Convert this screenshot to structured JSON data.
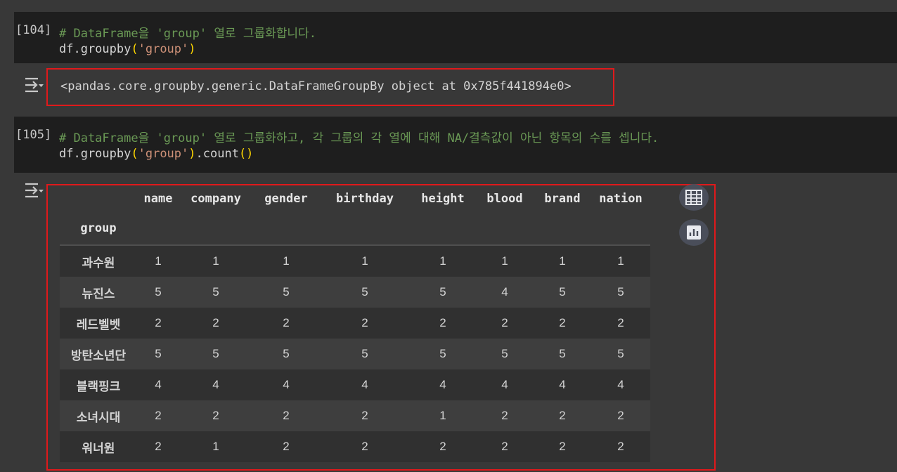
{
  "cell104": {
    "prompt": "[104]",
    "comment": "# DataFrame을 'group' 열로 그룹화합니다.",
    "code_obj": "df.groupby",
    "code_open": "(",
    "code_arg": "'group'",
    "code_close": ")",
    "output": "<pandas.core.groupby.generic.DataFrameGroupBy object at 0x785f441894e0>"
  },
  "cell105": {
    "prompt": "[105]",
    "comment": "# DataFrame을 'group' 열로 그룹화하고, 각 그룹의 각 열에 대해 NA/결측값이 아닌 항목의 수를 셉니다.",
    "code_obj": "df.groupby",
    "code_open": "(",
    "code_arg": "'group'",
    "code_close": ")",
    "code_tail": ".count",
    "code_tail_parens": "()"
  },
  "dataframe": {
    "index_name": "group",
    "columns": [
      "name",
      "company",
      "gender",
      "birthday",
      "height",
      "blood",
      "brand",
      "nation"
    ],
    "rows": [
      {
        "index": "과수원",
        "values": [
          "1",
          "1",
          "1",
          "1",
          "1",
          "1",
          "1",
          "1"
        ]
      },
      {
        "index": "뉴진스",
        "values": [
          "5",
          "5",
          "5",
          "5",
          "5",
          "4",
          "5",
          "5"
        ]
      },
      {
        "index": "레드벨벳",
        "values": [
          "2",
          "2",
          "2",
          "2",
          "2",
          "2",
          "2",
          "2"
        ]
      },
      {
        "index": "방탄소년단",
        "values": [
          "5",
          "5",
          "5",
          "5",
          "5",
          "5",
          "5",
          "5"
        ]
      },
      {
        "index": "블랙핑크",
        "values": [
          "4",
          "4",
          "4",
          "4",
          "4",
          "4",
          "4",
          "4"
        ]
      },
      {
        "index": "소녀시대",
        "values": [
          "2",
          "2",
          "2",
          "2",
          "1",
          "2",
          "2",
          "2"
        ]
      },
      {
        "index": "워너원",
        "values": [
          "2",
          "1",
          "2",
          "2",
          "2",
          "2",
          "2",
          "2"
        ]
      }
    ]
  },
  "icons": {
    "output": "output-toggle-icon",
    "table": "table-icon",
    "chart": "bar-chart-icon"
  }
}
